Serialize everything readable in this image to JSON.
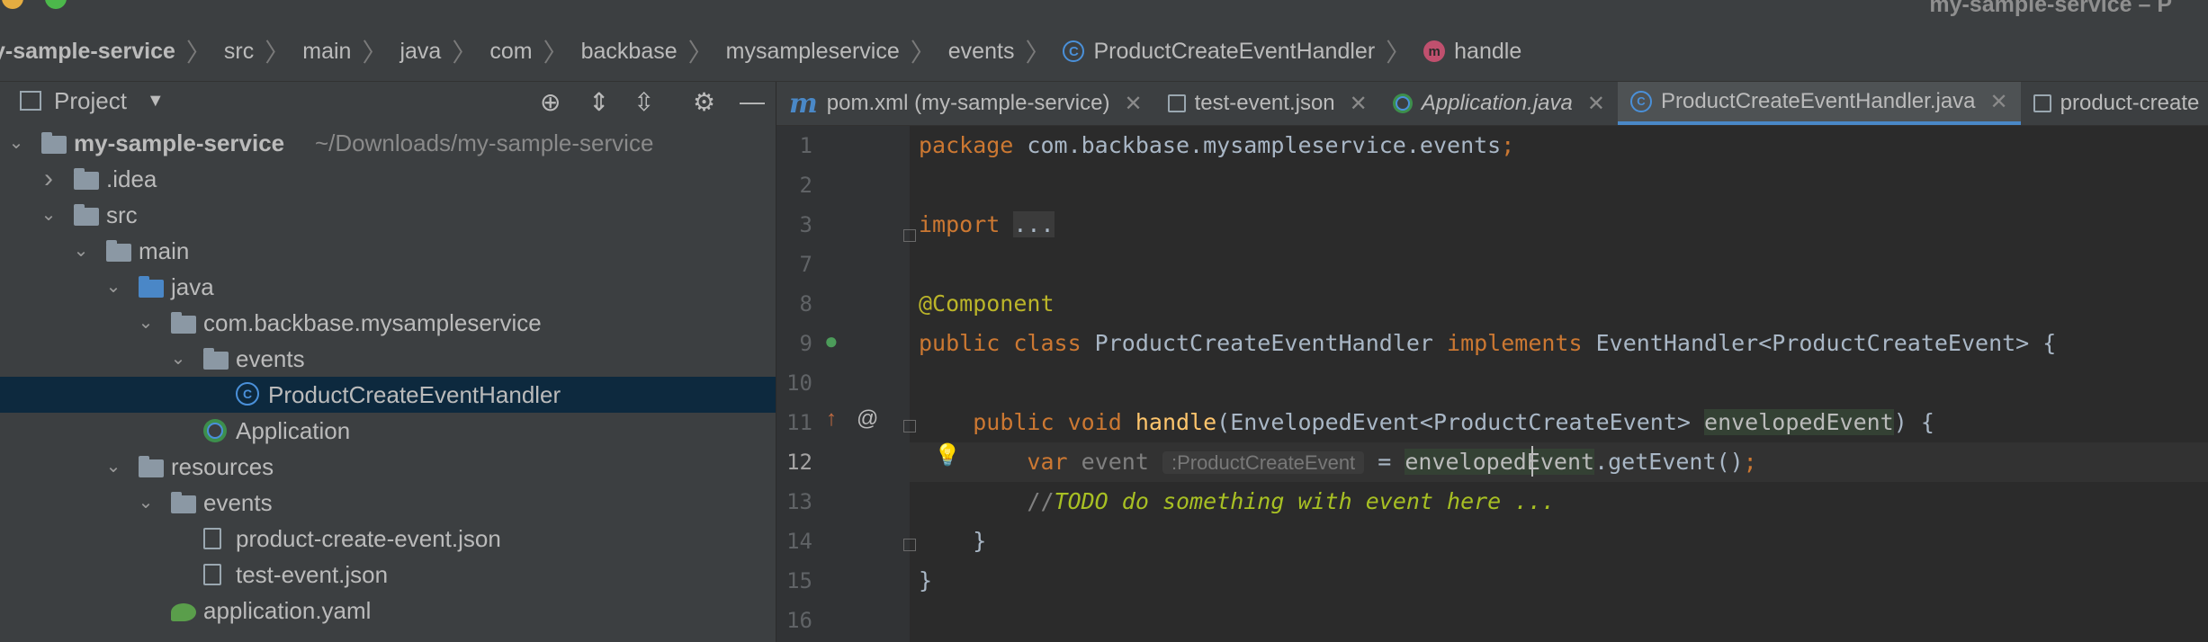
{
  "window": {
    "title": "my-sample-service – P"
  },
  "breadcrumb": [
    {
      "label": "y-sample-service",
      "icon": "folder-icon"
    },
    {
      "label": "src"
    },
    {
      "label": "main"
    },
    {
      "label": "java"
    },
    {
      "label": "com"
    },
    {
      "label": "backbase"
    },
    {
      "label": "mysampleservice"
    },
    {
      "label": "events"
    },
    {
      "label": "ProductCreateEventHandler",
      "icon": "class-icon",
      "badge": "C"
    },
    {
      "label": "handle",
      "icon": "method-icon",
      "badge": "m"
    }
  ],
  "project": {
    "title": "Project",
    "tree": [
      {
        "label": "my-sample-service",
        "path": "~/Downloads/my-sample-service",
        "arrow": "expanded",
        "icon": "module-folder-icon"
      },
      {
        "label": ".idea",
        "arrow": "collapsed",
        "icon": "folder-icon"
      },
      {
        "label": "src",
        "arrow": "expanded",
        "icon": "folder-icon"
      },
      {
        "label": "main",
        "arrow": "expanded",
        "icon": "folder-icon"
      },
      {
        "label": "java",
        "arrow": "expanded",
        "icon": "source-folder-icon"
      },
      {
        "label": "com.backbase.mysampleservice",
        "arrow": "expanded",
        "icon": "package-icon"
      },
      {
        "label": "events",
        "arrow": "expanded",
        "icon": "package-icon"
      },
      {
        "label": "ProductCreateEventHandler",
        "icon": "class-icon",
        "badge": "C",
        "selected": true
      },
      {
        "label": "Application",
        "icon": "spring-app-icon"
      },
      {
        "label": "resources",
        "arrow": "expanded",
        "icon": "resources-folder-icon"
      },
      {
        "label": "events",
        "arrow": "expanded",
        "icon": "folder-icon"
      },
      {
        "label": "product-create-event.json",
        "icon": "json-file-icon"
      },
      {
        "label": "test-event.json",
        "icon": "json-file-icon"
      },
      {
        "label": "application.yaml",
        "icon": "yaml-file-icon"
      }
    ]
  },
  "tabs": [
    {
      "label": "pom.xml (my-sample-service)",
      "icon": "maven-icon",
      "glyph": "m",
      "active": false,
      "italic": false
    },
    {
      "label": "test-event.json",
      "icon": "json-file-icon",
      "active": false,
      "italic": false
    },
    {
      "label": "Application.java",
      "icon": "spring-app-icon",
      "active": false,
      "italic": true
    },
    {
      "label": "ProductCreateEventHandler.java",
      "icon": "class-icon",
      "badge": "C",
      "active": true,
      "italic": false
    },
    {
      "label": "product-create",
      "icon": "json-file-icon",
      "active": false,
      "italic": false
    }
  ],
  "editor": {
    "current_line": "12",
    "lines": [
      {
        "num": "1",
        "tokens": [
          [
            "kw",
            "package "
          ],
          [
            "tx",
            "com.backbase.mysampleservice.events"
          ],
          [
            "kw",
            ";"
          ]
        ]
      },
      {
        "num": "2",
        "tokens": []
      },
      {
        "num": "3",
        "tokens": [
          [
            "kw",
            "import "
          ],
          [
            "fold",
            "..."
          ]
        ]
      },
      {
        "num": "7",
        "tokens": []
      },
      {
        "num": "8",
        "tokens": [
          [
            "ann",
            "@Component"
          ]
        ]
      },
      {
        "num": "9",
        "tokens": [
          [
            "kw",
            "public class "
          ],
          [
            "tx",
            "ProductCreateEventHandler "
          ],
          [
            "kw",
            "implements "
          ],
          [
            "tx",
            "EventHandler<ProductCreateEvent> {"
          ]
        ]
      },
      {
        "num": "10",
        "tokens": []
      },
      {
        "num": "11",
        "tokens": [
          [
            "tx",
            "    "
          ],
          [
            "kw",
            "public void "
          ],
          [
            "fn",
            "handle"
          ],
          [
            "tx",
            "(EnvelopedEvent<ProductCreateEvent> "
          ],
          [
            "hl",
            "envelopedEvent"
          ],
          [
            "tx",
            ") {"
          ]
        ]
      },
      {
        "num": "12",
        "tokens": [
          [
            "tx",
            "        "
          ],
          [
            "kw",
            "var "
          ],
          [
            "cm",
            "event "
          ],
          [
            "hint",
            ":ProductCreateEvent"
          ],
          [
            "tx",
            " = "
          ],
          [
            "hl",
            "envelopedEvent"
          ],
          [
            "tx",
            ".getEvent()"
          ],
          [
            "kw",
            ";"
          ]
        ]
      },
      {
        "num": "13",
        "tokens": [
          [
            "tx",
            "        "
          ],
          [
            "cm",
            "//"
          ],
          [
            "todo",
            "TODO do something with event here ..."
          ]
        ]
      },
      {
        "num": "14",
        "tokens": [
          [
            "tx",
            "    }"
          ]
        ]
      },
      {
        "num": "15",
        "tokens": [
          [
            "tx",
            "}"
          ]
        ]
      },
      {
        "num": "16",
        "tokens": []
      }
    ]
  },
  "colors": {
    "accent": "#4a88c7",
    "keyword": "#cc7832",
    "annotation": "#bbb529",
    "method": "#ffc66d",
    "todo": "#a8c023"
  }
}
